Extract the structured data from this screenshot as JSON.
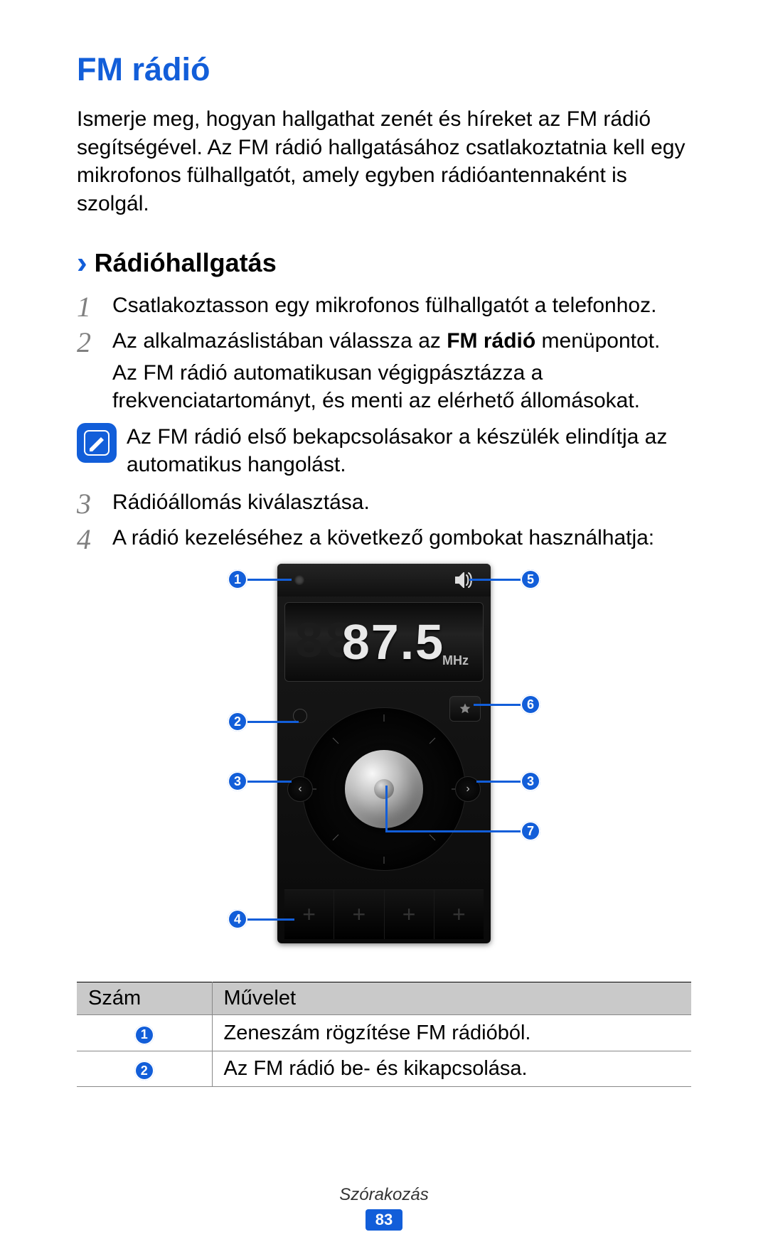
{
  "title": "FM rádió",
  "intro": "Ismerje meg, hogyan hallgathat zenét és híreket az FM rádió segítségével. Az FM rádió hallgatásához csatlakoztatnia kell egy mikrofonos fülhallgatót, amely egyben rádióantennaként is szolgál.",
  "subhead": "Rádióhallgatás",
  "steps": {
    "s1_num": "1",
    "s1": "Csatlakoztasson egy mikrofonos fülhallgatót a telefonhoz.",
    "s2_num": "2",
    "s2a_pre": "Az alkalmazáslistában válassza az ",
    "s2a_bold": "FM rádió",
    "s2a_post": " menüpontot.",
    "s2b": "Az FM rádió automatikusan végigpásztázza a frekvenciatartományt, és menti az elérhető állomásokat.",
    "s3_num": "3",
    "s3": "Rádióállomás kiválasztása.",
    "s4_num": "4",
    "s4": "A rádió kezeléséhez a következő gombokat használhatja:"
  },
  "note": "Az FM rádió első bekapcsolásakor a készülék elindítja az automatikus hangolást.",
  "radio": {
    "ghost": "88",
    "freq": "87.5",
    "mhz": "MHz",
    "seek_left": "‹",
    "seek_right": "›",
    "plus": "+"
  },
  "callouts": {
    "n1": "1",
    "n2": "2",
    "n3": "3",
    "n4": "4",
    "n5": "5",
    "n6": "6",
    "n7": "7"
  },
  "table": {
    "h1": "Szám",
    "h2": "Művelet",
    "r1": "Zeneszám rögzítése FM rádióból.",
    "r2": "Az FM rádió be- és kikapcsolása."
  },
  "footer": {
    "section": "Szórakozás",
    "page": "83"
  }
}
